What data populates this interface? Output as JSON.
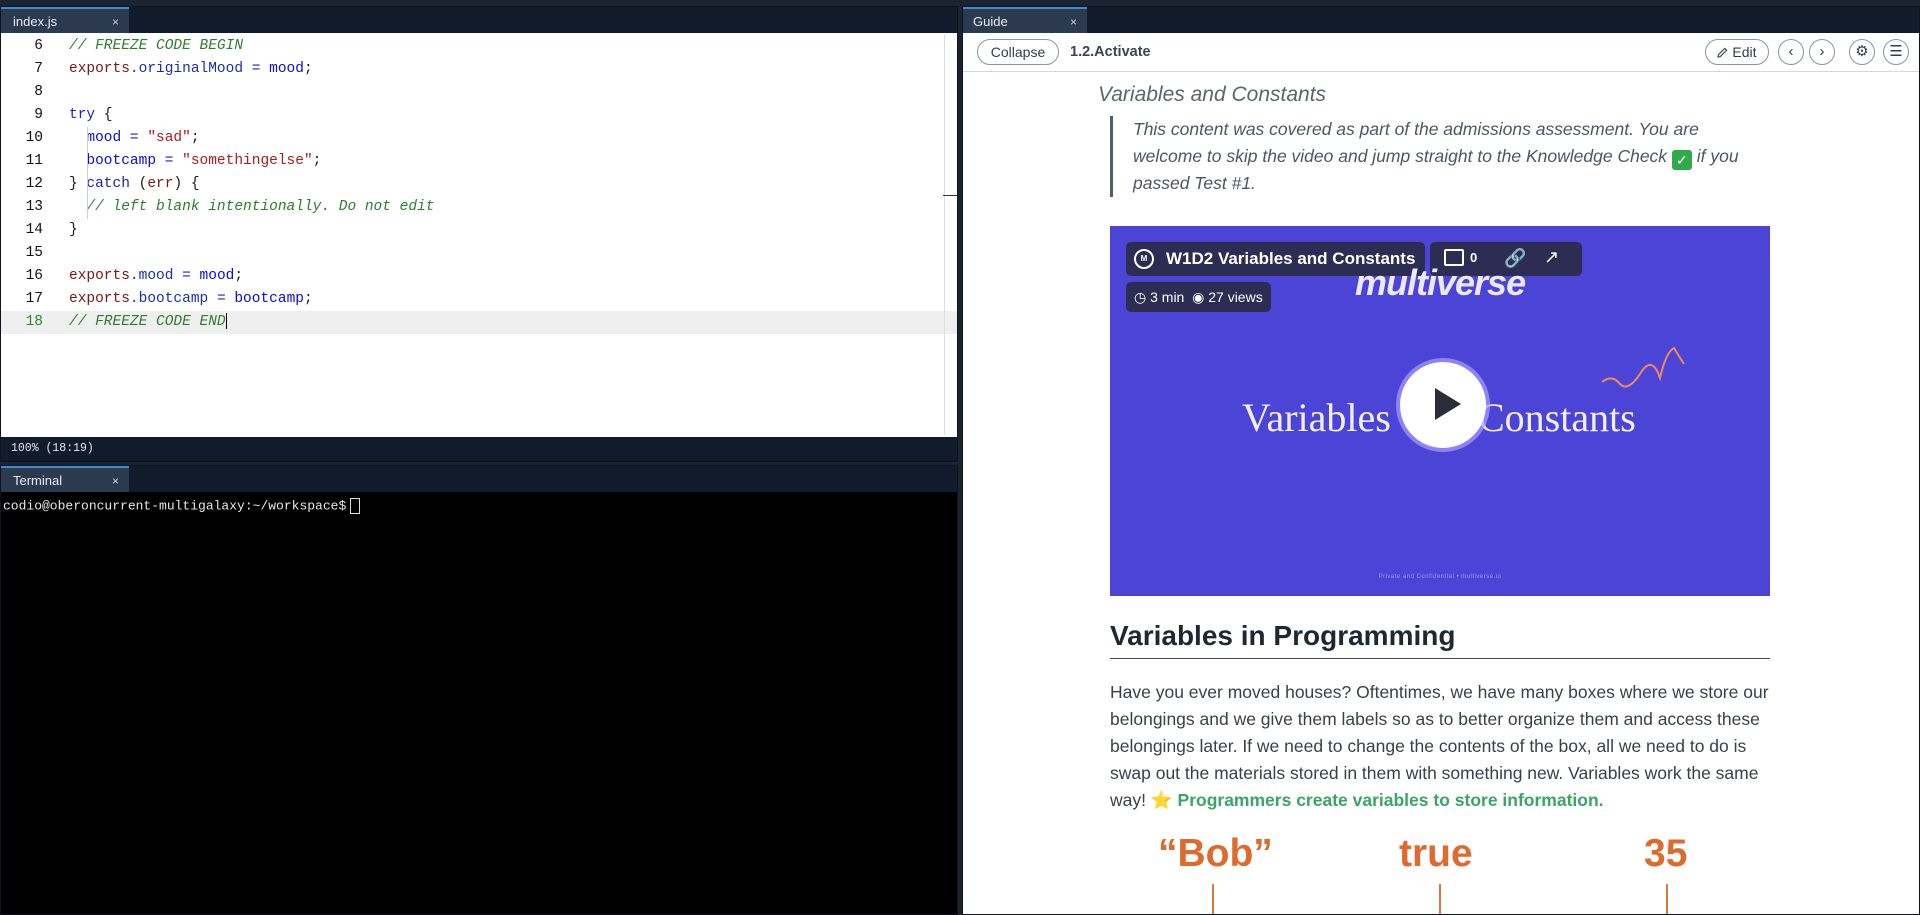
{
  "editor": {
    "tab_label": "index.js",
    "tab_close": "×",
    "lines": [
      {
        "num": "6"
      },
      {
        "num": "7"
      },
      {
        "num": "8"
      },
      {
        "num": "9"
      },
      {
        "num": "10"
      },
      {
        "num": "11"
      },
      {
        "num": "12"
      },
      {
        "num": "13"
      },
      {
        "num": "14"
      },
      {
        "num": "15"
      },
      {
        "num": "16"
      },
      {
        "num": "17"
      },
      {
        "num": "18"
      }
    ],
    "code": {
      "l6": "// FREEZE CODE BEGIN",
      "l7_obj": "exports",
      "l7_prop": ".originalMood",
      "l7_op": " = ",
      "l7_val": "mood",
      "l7_end": ";",
      "l9_kw": "try",
      "l9_brace": " {",
      "l10_id": "  mood",
      "l10_op": " = ",
      "l10_str": "\"sad\"",
      "l10_end": ";",
      "l11_id": "  bootcamp",
      "l11_op": " = ",
      "l11_str": "\"somethingelse\"",
      "l11_end": ";",
      "l12_a": "} ",
      "l12_kw": "catch",
      "l12_b": " (",
      "l12_err": "err",
      "l12_c": ") {",
      "l13": "  // left blank intentionally. Do not edit",
      "l14": "}",
      "l16_obj": "exports",
      "l16_prop": ".mood",
      "l16_op": " = ",
      "l16_val": "mood",
      "l16_end": ";",
      "l17_obj": "exports",
      "l17_prop": ".bootcamp",
      "l17_op": " = ",
      "l17_val": "bootcamp",
      "l17_end": ";",
      "l18": "// FREEZE CODE END"
    },
    "status": "100%  (18:19)"
  },
  "terminal": {
    "tab_label": "Terminal",
    "tab_close": "×",
    "prompt": "codio@oberoncurrent-multigalaxy:~/workspace$"
  },
  "guide": {
    "tab_label": "Guide",
    "tab_close": "×",
    "collapse_label": "Collapse",
    "breadcrumb": "1.2.Activate",
    "edit_label": "Edit",
    "section_title": "Variables and Constants",
    "quote_before": "This content was covered as part of the admissions assessment. You are welcome to skip the video and jump straight to the Knowledge Check ",
    "quote_after": " if you passed Test #1.",
    "video": {
      "title": "W1D2 Variables and Constants",
      "comments": "0",
      "duration": "3 min",
      "views": "27 views",
      "brand": "multiverse",
      "word_left": "Variables",
      "word_right": "Constants",
      "footer": "Private and Confidential   •   multiverse.io"
    },
    "heading": "Variables in Programming",
    "paragraph": "Have you ever moved houses? Oftentimes, we have many boxes where we store our belongings and we give them labels so as to better organize them and access these belongings later. If we need to change the contents of the box, all we need to do is swap out the materials stored in them with something new. Variables work the same way! ",
    "highlight": "Programmers create variables to store information.",
    "values": [
      "“Bob”",
      "true",
      "35"
    ]
  },
  "colors": {
    "accent_green": "#3aa564",
    "video_bg": "#4b44d6",
    "orange": "#de6a2e"
  }
}
